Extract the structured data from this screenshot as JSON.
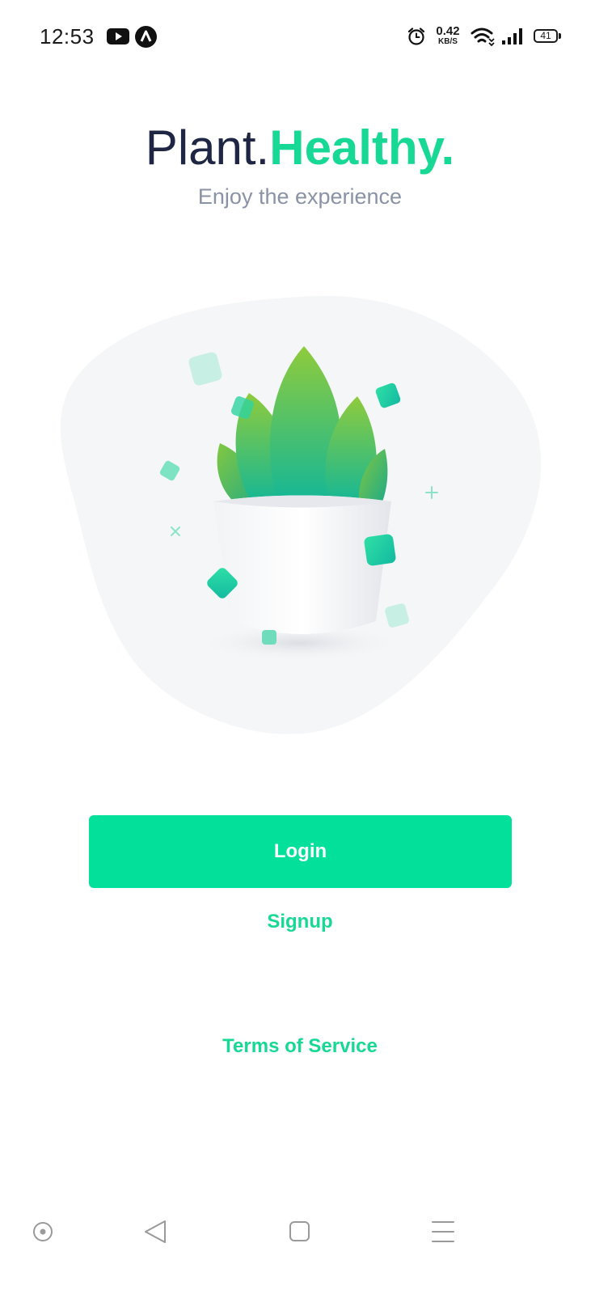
{
  "status_bar": {
    "time": "12:53",
    "net_speed_value": "0.42",
    "net_speed_unit": "KB/S",
    "battery_level": "41",
    "icons": [
      "youtube-icon",
      "app-notification-icon",
      "alarm-icon",
      "wifi-icon",
      "signal-icon",
      "battery-icon"
    ]
  },
  "header": {
    "title_part1": "Plant.",
    "title_part2": "Healthy.",
    "subtitle": "Enjoy the experience"
  },
  "illustration": {
    "icon": "potted-plant-illustration"
  },
  "actions": {
    "login_label": "Login",
    "signup_label": "Signup",
    "terms_label": "Terms of Service"
  },
  "nav_bar": {
    "icons": [
      "accessibility-dot-icon",
      "back-icon",
      "home-icon",
      "menu-icon"
    ]
  },
  "colors": {
    "accent": "#03e09a",
    "link": "#17d894",
    "title_dark": "#1e2643",
    "subtitle_gray": "#8a92a6"
  }
}
